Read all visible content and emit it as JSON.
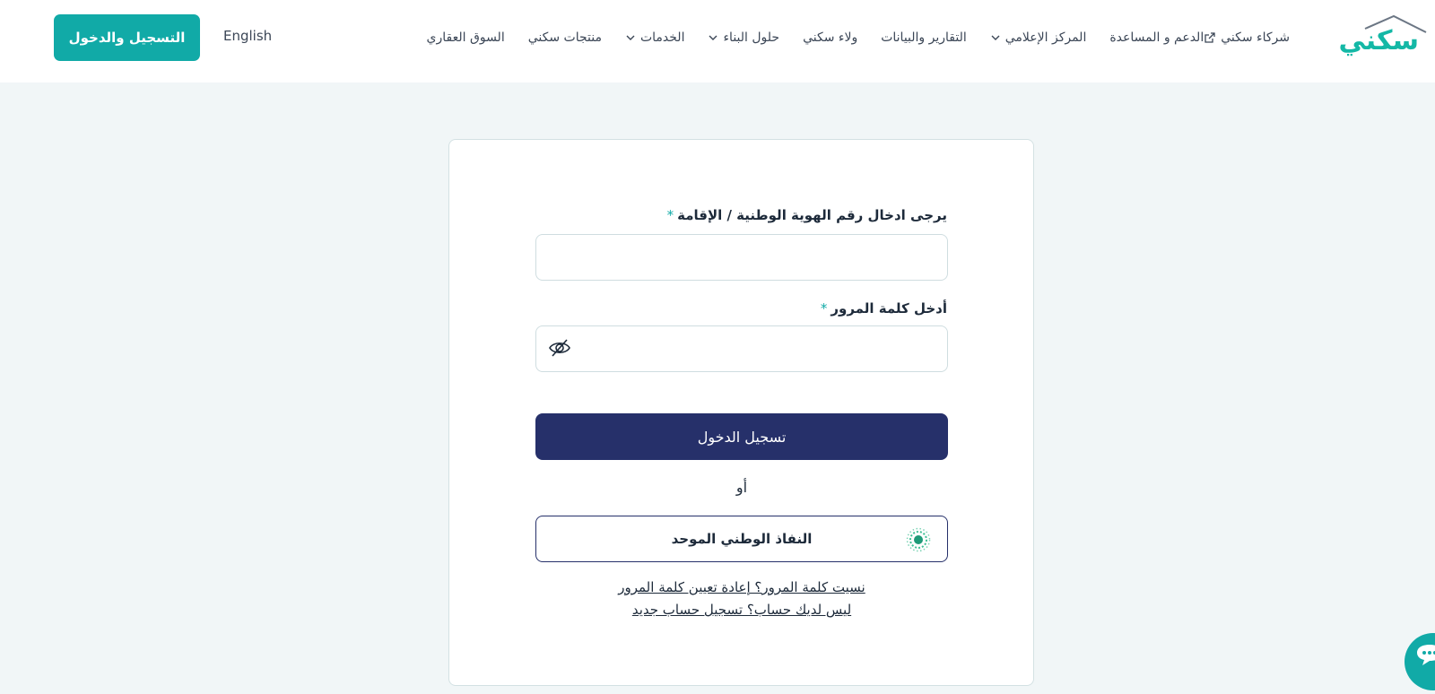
{
  "header": {
    "logo_text": "سكني",
    "nav": [
      {
        "label": "السوق العقاري",
        "dropdown": false
      },
      {
        "label": "منتجات سكني",
        "dropdown": false
      },
      {
        "label": "الخدمات",
        "dropdown": true
      },
      {
        "label": "حلول البناء",
        "dropdown": true
      },
      {
        "label": "ولاء سكني",
        "dropdown": false
      },
      {
        "label": "التقارير والبيانات",
        "dropdown": false
      },
      {
        "label": "المركز الإعلامي",
        "dropdown": true
      },
      {
        "label": "الدعم و المساعدة",
        "dropdown": false
      },
      {
        "label": "شركاء سكني",
        "external": true
      }
    ],
    "language_label": "English",
    "login_button_label": "التسجيل والدخول"
  },
  "form": {
    "id_label": "يرجى ادخال رقم الهوية الوطنية / الإقامة",
    "password_label": "أدخل كلمة المرور",
    "required_marker": "*",
    "id_value": "",
    "password_value": "",
    "submit_label": "تسجيل الدخول",
    "or_label": "أو",
    "nafath_label": "النفاذ الوطني الموحد",
    "forgot_password_link": "نسيت كلمة المرور؟ إعادة تعيين كلمة المرور",
    "register_link": "ليس لديك حساب؟ تسجيل حساب جديد"
  },
  "colors": {
    "brand_teal": "#11aaa7",
    "primary_navy": "#26306a",
    "background": "#f1f6f7"
  }
}
